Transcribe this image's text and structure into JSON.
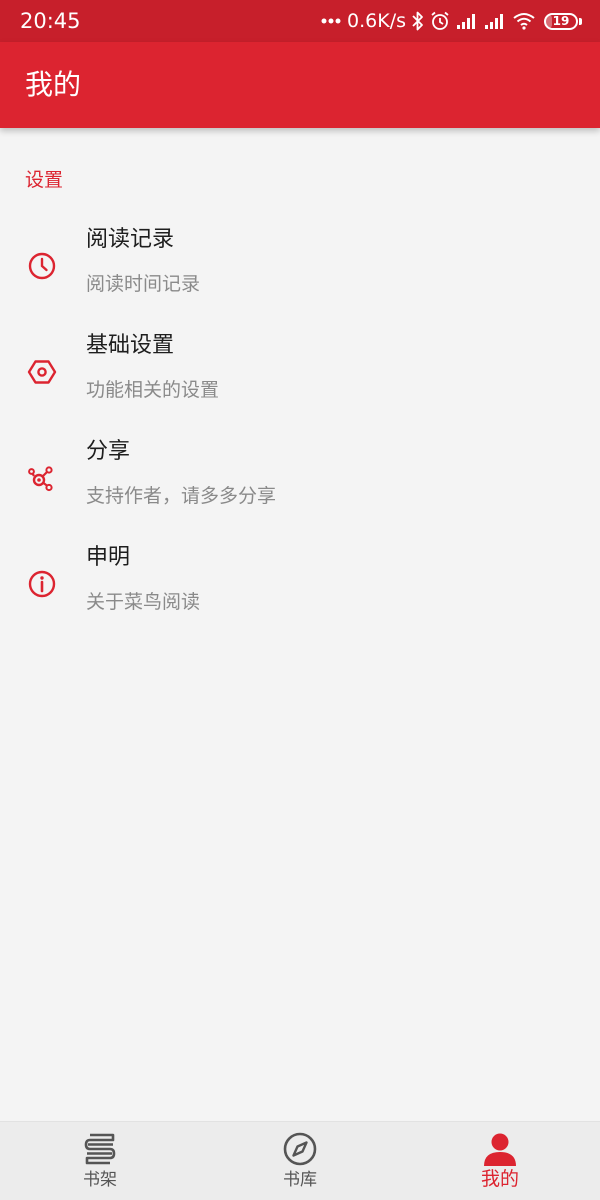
{
  "status_bar": {
    "time": "20:45",
    "speed": "0.6K/s",
    "battery_level": "19",
    "icons": [
      "more-dots-icon",
      "bluetooth-icon",
      "alarm-icon",
      "signal-icon",
      "signal-icon",
      "wifi-icon",
      "battery-icon"
    ]
  },
  "app_bar": {
    "title": "我的"
  },
  "section": {
    "header": "设置"
  },
  "items": [
    {
      "icon": "clock-icon",
      "title": "阅读记录",
      "subtitle": "阅读时间记录"
    },
    {
      "icon": "hexagon-nut-icon",
      "title": "基础设置",
      "subtitle": "功能相关的设置"
    },
    {
      "icon": "share-icon",
      "title": "分享",
      "subtitle": "支持作者，请多多分享"
    },
    {
      "icon": "info-icon",
      "title": "申明",
      "subtitle": "关于菜鸟阅读"
    }
  ],
  "bottom_nav": {
    "tabs": [
      {
        "label": "书架",
        "icon": "bookshelf-icon",
        "active": false
      },
      {
        "label": "书库",
        "icon": "compass-icon",
        "active": false
      },
      {
        "label": "我的",
        "icon": "person-icon",
        "active": true
      }
    ]
  },
  "colors": {
    "accent": "#dc2430",
    "status_bar": "#c71f2b",
    "background": "#f4f4f4",
    "nav_inactive": "#555555"
  }
}
